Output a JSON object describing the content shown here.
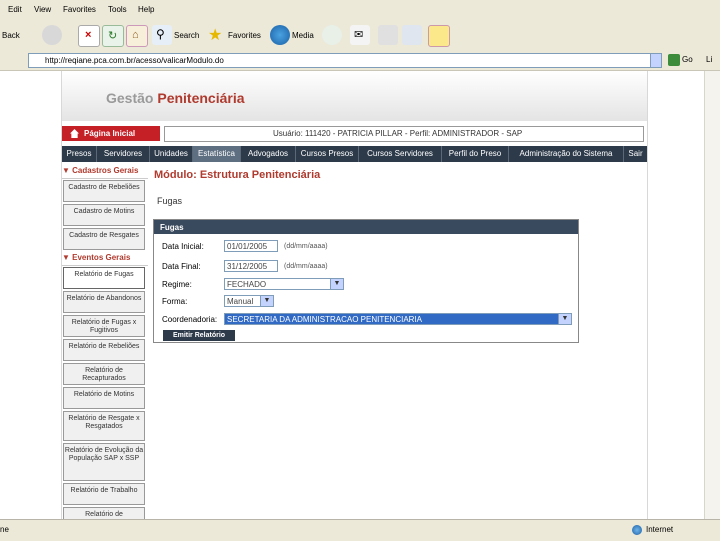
{
  "menubar": {
    "items": [
      "Edit",
      "View",
      "Favorites",
      "Tools",
      "Help"
    ]
  },
  "toolbar": {
    "back_label": "Back",
    "search_label": "Search",
    "favorites_label": "Favorites",
    "media_label": "Media"
  },
  "address": {
    "url": "http://reqiane.pca.com.br/acesso/valicarModulo.do",
    "go_label": "Go",
    "links_label": "Li"
  },
  "header": {
    "logo_part1": "Gestão",
    "logo_part2": "Penitenciária",
    "home_label": "Página Inicial",
    "user_info": "Usuário: 111420 - PATRICIA PILLAR - Perfil: ADMINISTRADOR - SAP"
  },
  "nav": {
    "items": [
      "Presos",
      "Servidores",
      "Unidades",
      "Estatística",
      "Advogados",
      "Cursos Presos",
      "Cursos Servidores",
      "Perfil do Preso",
      "Administração do Sistema",
      "Sair"
    ]
  },
  "sidebar": {
    "section1": "Cadastros Gerais",
    "section1_items": [
      "Cadastro de Rebeliões",
      "Cadastro de Motins",
      "Cadastro de Resgates"
    ],
    "section2": "Eventos Gerais",
    "section2_items": [
      "Relatório de Fugas",
      "Relatório de Abandonos",
      "Relatório de Fugas x Fugitivos",
      "Relatório de Rebeliões",
      "Relatório de Recapturados",
      "Relatório de Motins",
      "Relatório de Resgate x Resgatados",
      "Relatório de Evolução da População SAP x SSP",
      "Relatório de Trabalho",
      "Relatório de"
    ]
  },
  "main": {
    "title": "Módulo: Estrutura Penitenciária",
    "subtitle": "Fugas",
    "form_title": "Fugas",
    "data_inicial_label": "Data Inicial:",
    "data_inicial_value": "01/01/2005",
    "data_final_label": "Data Final:",
    "data_final_value": "31/12/2005",
    "date_hint": "(dd/mm/aaaa)",
    "regime_label": "Regime:",
    "regime_value": "FECHADO",
    "forma_label": "Forma:",
    "forma_value": "Manual",
    "coord_label": "Coordenadoria:",
    "coord_value": "SECRETARIA DA ADMINISTRACAO PENITENCIARIA",
    "emit_label": "Emitir Relatório"
  },
  "status": {
    "left": "ne",
    "zone": "Internet"
  },
  "colors": {
    "brand_red": "#b03a2e",
    "nav_dark": "#2d3a4a"
  }
}
